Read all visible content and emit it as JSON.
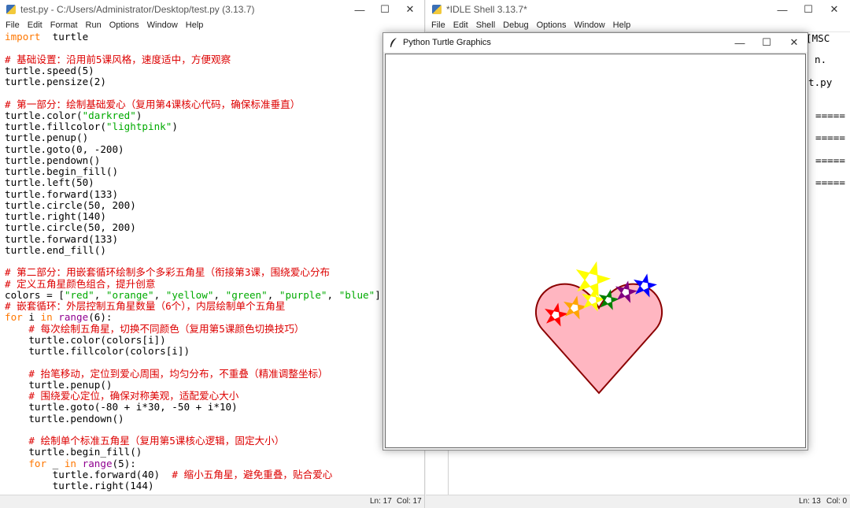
{
  "editor_window": {
    "title": "test.py - C:/Users/Administrator/Desktop/test.py (3.13.7)",
    "controls": {
      "minimize": "—",
      "maximize": "☐",
      "close": "✕"
    },
    "menu": [
      "File",
      "Edit",
      "Format",
      "Run",
      "Options",
      "Window",
      "Help"
    ],
    "code_lines": [
      [
        [
          "kw",
          "import"
        ],
        [
          "",
          "  turtle"
        ]
      ],
      [],
      [
        [
          "cm",
          "# 基础设置：沿用前5课风格，速度适中，方便观察"
        ]
      ],
      [
        [
          "",
          "turtle.speed(5)"
        ]
      ],
      [
        [
          "",
          "turtle.pensize(2)"
        ]
      ],
      [],
      [
        [
          "cm",
          "# 第一部分：绘制基础爱心（复用第4课核心代码，确保标准垂直）"
        ]
      ],
      [
        [
          "",
          "turtle.color("
        ],
        [
          "st",
          "\"darkred\""
        ],
        [
          "",
          ")"
        ]
      ],
      [
        [
          "",
          "turtle.fillcolor("
        ],
        [
          "st",
          "\"lightpink\""
        ],
        [
          "",
          ")"
        ]
      ],
      [
        [
          "",
          "turtle.penup()"
        ]
      ],
      [
        [
          "",
          "turtle.goto(0, -200)"
        ]
      ],
      [
        [
          "",
          "turtle.pendown()"
        ]
      ],
      [
        [
          "",
          "turtle.begin_fill()"
        ]
      ],
      [
        [
          "",
          "turtle.left(50)"
        ]
      ],
      [
        [
          "",
          "turtle.forward(133)"
        ]
      ],
      [
        [
          "",
          "turtle.circle(50, 200)"
        ]
      ],
      [
        [
          "",
          "turtle.right(140)"
        ]
      ],
      [
        [
          "",
          "turtle.circle(50, 200)"
        ]
      ],
      [
        [
          "",
          "turtle.forward(133)"
        ]
      ],
      [
        [
          "",
          "turtle.end_fill()"
        ]
      ],
      [],
      [
        [
          "cm",
          "# 第二部分：用嵌套循环绘制多个多彩五角星（衔接第3课，围绕爱心分布"
        ]
      ],
      [
        [
          "cm",
          "# 定义五角星颜色组合，提升创意"
        ]
      ],
      [
        [
          "",
          "colors = ["
        ],
        [
          "st",
          "\"red\""
        ],
        [
          "",
          ", "
        ],
        [
          "st",
          "\"orange\""
        ],
        [
          "",
          ", "
        ],
        [
          "st",
          "\"yellow\""
        ],
        [
          "",
          ", "
        ],
        [
          "st",
          "\"green\""
        ],
        [
          "",
          ", "
        ],
        [
          "st",
          "\"purple\""
        ],
        [
          "",
          ", "
        ],
        [
          "st",
          "\"blue\""
        ],
        [
          "",
          "]"
        ]
      ],
      [
        [
          "cm",
          "# 嵌套循环：外层控制五角星数量（6个），内层绘制单个五角星"
        ]
      ],
      [
        [
          "kw",
          "for"
        ],
        [
          "",
          " i "
        ],
        [
          "kw",
          "in"
        ],
        [
          "",
          " "
        ],
        [
          "bi",
          "range"
        ],
        [
          "",
          "(6):"
        ]
      ],
      [
        [
          "",
          "    "
        ],
        [
          "cm",
          "# 每次绘制五角星，切换不同颜色（复用第5课颜色切换技巧）"
        ]
      ],
      [
        [
          "",
          "    turtle.color(colors[i])"
        ]
      ],
      [
        [
          "",
          "    turtle.fillcolor(colors[i])"
        ]
      ],
      [],
      [
        [
          "",
          "    "
        ],
        [
          "cm",
          "# 抬笔移动，定位到爱心周围，均匀分布，不重叠（精准调整坐标）"
        ]
      ],
      [
        [
          "",
          "    turtle.penup()"
        ]
      ],
      [
        [
          "",
          "    "
        ],
        [
          "cm",
          "# 围绕爱心定位，确保对称美观，适配爱心大小"
        ]
      ],
      [
        [
          "",
          "    turtle.goto(-80 + i*30, -50 + i*10)"
        ]
      ],
      [
        [
          "",
          "    turtle.pendown()"
        ]
      ],
      [],
      [
        [
          "",
          "    "
        ],
        [
          "cm",
          "# 绘制单个标准五角星（复用第5课核心逻辑，固定大小）"
        ]
      ],
      [
        [
          "",
          "    turtle.begin_fill()"
        ]
      ],
      [
        [
          "",
          "    "
        ],
        [
          "kw",
          "for"
        ],
        [
          "",
          " _ "
        ],
        [
          "kw",
          "in"
        ],
        [
          "",
          " "
        ],
        [
          "bi",
          "range"
        ],
        [
          "",
          "(5):"
        ]
      ],
      [
        [
          "",
          "        turtle.forward(40)  "
        ],
        [
          "cm",
          "# 缩小五角星，避免重叠，贴合爱心"
        ]
      ],
      [
        [
          "",
          "        turtle.right(144)"
        ]
      ]
    ],
    "status": {
      "line": "Ln: 17",
      "col": "Col: 17"
    }
  },
  "shell_window": {
    "title": "*IDLE Shell 3.13.7*",
    "controls": {
      "minimize": "—",
      "maximize": "☐",
      "close": "✕"
    },
    "menu": [
      "File",
      "Edit",
      "Shell",
      "Debug",
      "Options",
      "Window",
      "Help"
    ],
    "visible_text": {
      "msc": "[MSC",
      "period": "n.",
      "py": "t.py",
      "sep1": "=====",
      "sep2": "=====",
      "sep3": "=====",
      "sep4": "====="
    },
    "status": {
      "line": "Ln: 13",
      "col": "Col: 0"
    }
  },
  "turtle_window": {
    "title": "Python Turtle Graphics",
    "controls": {
      "minimize": "—",
      "maximize": "☐",
      "close": "✕"
    },
    "drawing": {
      "heart_outline": "#8b0000",
      "heart_fill": "#ffb6c1",
      "star_colors": [
        "#ff0000",
        "#ffa500",
        "#ffff00",
        "#008000",
        "#800080",
        "#0000ff"
      ]
    }
  }
}
